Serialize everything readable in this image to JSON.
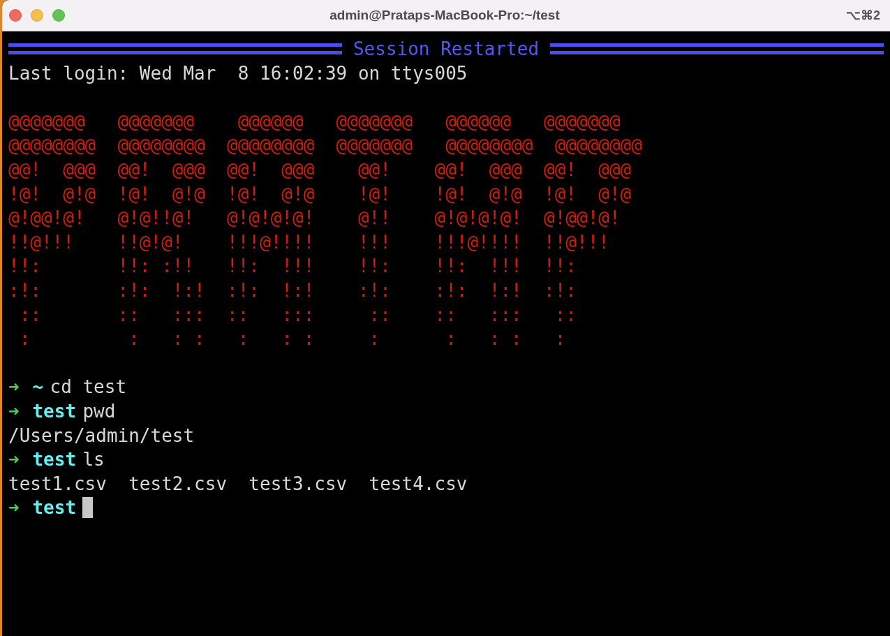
{
  "window": {
    "title": "admin@Prataps-MacBook-Pro:~/test",
    "shortcut": "⌥⌘2"
  },
  "banner": {
    "text": "Session Restarted"
  },
  "login_line": "Last login: Wed Mar  8 16:02:39 on ttys005",
  "art": [
    "@@@@@@@   @@@@@@@    @@@@@@   @@@@@@@   @@@@@@   @@@@@@@",
    "@@@@@@@@  @@@@@@@@  @@@@@@@@  @@@@@@@   @@@@@@@@  @@@@@@@@",
    "@@!  @@@  @@!  @@@  @@!  @@@    @@!    @@!  @@@  @@!  @@@",
    "!@!  @!@  !@!  @!@  !@!  @!@    !@!    !@!  @!@  !@!  @!@",
    "@!@@!@!   @!@!!@!   @!@!@!@!    @!!    @!@!@!@!  @!@@!@!",
    "!!@!!!    !!@!@!    !!!@!!!!    !!!    !!!@!!!!  !!@!!!",
    "!!:       !!: :!!   !!:  !!!    !!:    !!:  !!!  !!:",
    ":!:       :!:  !:!  :!:  !:!    :!:    :!:  !:!  :!:",
    " ::       ::   :::  ::   :::     ::    ::   :::   ::",
    " :         :   : :   :   : :     :      :   : :   :"
  ],
  "history": [
    {
      "kind": "prompt",
      "arrow": "➜",
      "dir": "~",
      "command": "cd test",
      "cursor": false
    },
    {
      "kind": "prompt",
      "arrow": "➜",
      "dir": "test",
      "command": "pwd",
      "cursor": false
    },
    {
      "kind": "output",
      "text": "/Users/admin/test"
    },
    {
      "kind": "prompt",
      "arrow": "➜",
      "dir": "test",
      "command": "ls",
      "cursor": false
    },
    {
      "kind": "output",
      "text": "test1.csv  test2.csv  test3.csv  test4.csv"
    },
    {
      "kind": "prompt",
      "arrow": "➜",
      "dir": "test",
      "cursor": true
    }
  ]
}
